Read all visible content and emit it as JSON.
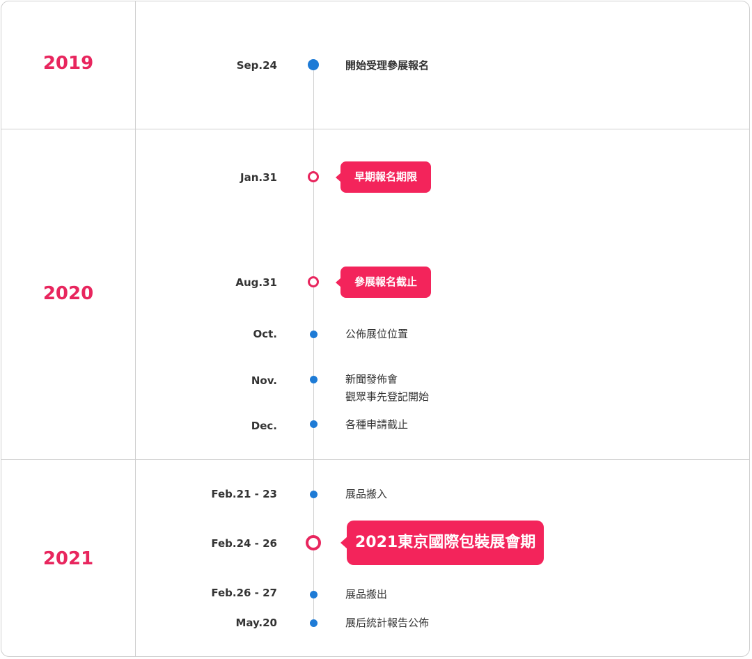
{
  "years": [
    "2019",
    "2020",
    "2021"
  ],
  "events": [
    {
      "date": "Sep.24",
      "lines": [
        "開始受理參展報名"
      ],
      "style": "bold"
    },
    {
      "date": "Jan.31",
      "lines": [
        "早期報名期限"
      ],
      "style": "bubble"
    },
    {
      "date": "Aug.31",
      "lines": [
        "參展報名截止"
      ],
      "style": "bubble"
    },
    {
      "date": "Oct.",
      "lines": [
        "公佈展位位置"
      ],
      "style": "normal"
    },
    {
      "date": "Nov.",
      "lines": [
        "新聞發佈會",
        "觀眾事先登記開始"
      ],
      "style": "normal"
    },
    {
      "date": "Dec.",
      "lines": [
        "各種申請截止"
      ],
      "style": "normal"
    },
    {
      "date": "Feb.21 - 23",
      "lines": [
        "展品搬入"
      ],
      "style": "normal"
    },
    {
      "date": "Feb.24 - 26",
      "lines": [
        "2021東京國際包裝展會期"
      ],
      "style": "bubble-large"
    },
    {
      "date": "Feb.26 - 27",
      "lines": [
        "展品搬出"
      ],
      "style": "normal"
    },
    {
      "date": "May.20",
      "lines": [
        "展后統計報告公佈"
      ],
      "style": "normal"
    }
  ],
  "colors": {
    "accent": "#f3245b",
    "year": "#e8265e",
    "dot": "#1e7bd6",
    "line": "#cfcfcf"
  }
}
